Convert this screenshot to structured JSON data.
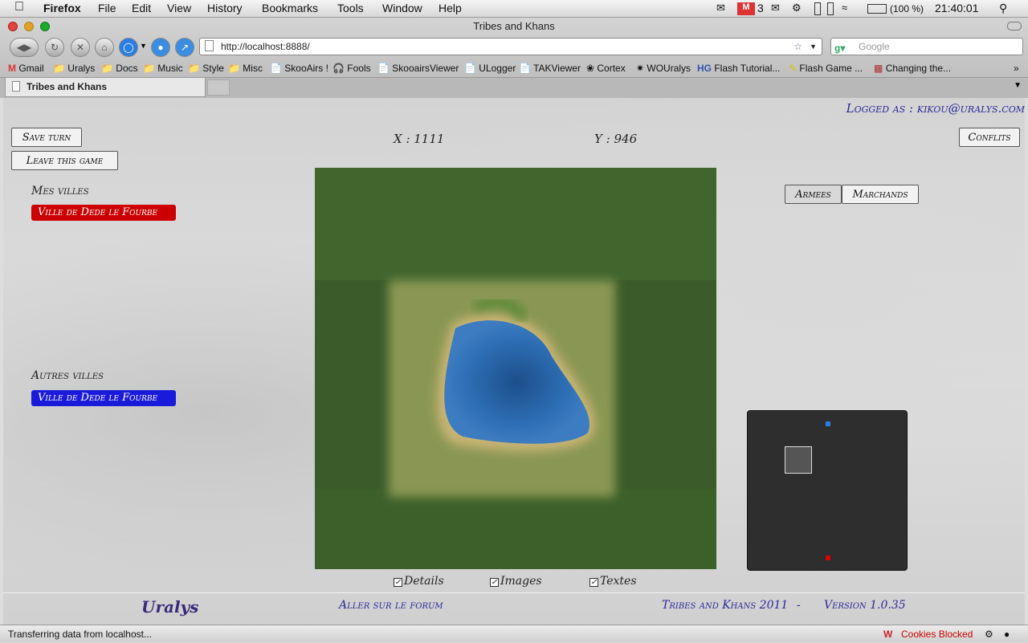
{
  "os_menu": {
    "app": "Firefox",
    "items": [
      "File",
      "Edit",
      "View",
      "History",
      "Bookmarks",
      "Tools",
      "Window",
      "Help"
    ],
    "mail_count": "3",
    "battery": "(100 %)",
    "clock": "21:40:01"
  },
  "browser": {
    "window_title": "Tribes and Khans",
    "url": "http://localhost:8888/",
    "search_placeholder": "Google",
    "bookmarks": [
      "Gmail",
      "Uralys",
      "Docs",
      "Music",
      "Style",
      "Misc",
      "SkooAirs !",
      "Fools",
      "SkooairsViewer",
      "ULogger",
      "TAKViewer",
      "Cortex",
      "WOUralys",
      "Flash Tutorial...",
      "Flash Game ...",
      "Changing the..."
    ],
    "tab_title": "Tribes and Khans",
    "status_text": "Transferring data from localhost...",
    "cookies_label": "Cookies Blocked"
  },
  "game": {
    "logged_as": "Logged as : kikou@uralys.com",
    "save_turn": "Save turn",
    "leave_game": "Leave this game",
    "conflits": "Conflits",
    "x_label": "X : 1111",
    "y_label": "Y : 946",
    "mes_villes_title": "Mes villes",
    "mes_villes": [
      "Ville de Dede le Fourbe"
    ],
    "autres_villes_title": "Autres villes",
    "autres_villes": [
      "Ville de Dede le Fourbe"
    ],
    "tabs": [
      "Armees",
      "Marchands"
    ],
    "checkboxes": [
      {
        "label": "Details",
        "checked": true
      },
      {
        "label": "Images",
        "checked": true
      },
      {
        "label": "Textes",
        "checked": true
      }
    ],
    "footer": {
      "logo": "Uralys",
      "forum_link": "Aller sur le forum",
      "game_name": "Tribes and Khans 2011",
      "separator": "-",
      "version": "Version 1.0.35"
    }
  },
  "colors": {
    "my_city": "#cc0000",
    "other_city": "#1a1adb",
    "link": "#2a2a9a",
    "minimap_bg": "#2e2e2e"
  }
}
